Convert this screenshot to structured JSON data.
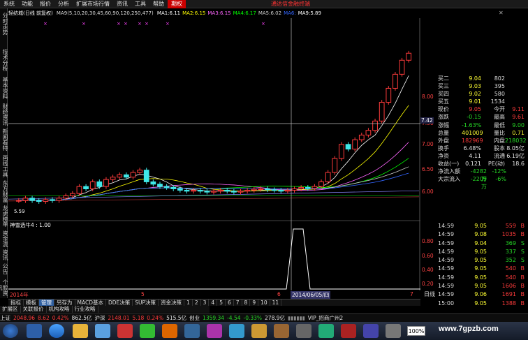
{
  "menu": {
    "items": [
      "系统",
      "功能",
      "报价",
      "分析",
      "扩展市场行情",
      "资讯",
      "工具",
      "帮助"
    ],
    "logo_item": "期权",
    "active_item": "期权",
    "promo_text": "通达信金融终端"
  },
  "side_tabs": [
    "分时走势",
    "技术分析",
    "基本资料",
    "财经资讯",
    "新闻看特",
    "画线工具",
    "东方财富",
    "龙虎榜",
    "单",
    "资金流",
    "资讯",
    "公告",
    "个股资讯"
  ],
  "chart_header": {
    "name": "轻纺城(日线 前复权)",
    "ma_spec": "MA9(5,10,20,30,45,60,90,120,250,477)",
    "mas": [
      {
        "label": "MA1:",
        "value": "6.11",
        "color": "#ffffff"
      },
      {
        "label": "MA2:",
        "value": "6.15",
        "color": "#ffff00"
      },
      {
        "label": "MA3:",
        "value": "6.15",
        "color": "#ff66ff"
      },
      {
        "label": "MA4:",
        "value": "6.17",
        "color": "#00ff00"
      },
      {
        "label": "MA5:",
        "value": "6.02",
        "color": "#cccccc"
      },
      {
        "label": "MA6:",
        "value": "",
        "color": "#3366ff"
      },
      {
        "label": "MA9:",
        "value": "5.89",
        "color": "#ffffff"
      }
    ]
  },
  "price_axis": {
    "labels": [
      "8.00",
      "7.50",
      "7.00",
      "6.50",
      "6.00"
    ],
    "crosshair_value": "7.42",
    "min_label": "5.59"
  },
  "indicator": {
    "title": "神雪选牛4 : 1.00",
    "axis_labels": [
      "0.80",
      "0.60",
      "0.40",
      "0.20"
    ]
  },
  "x_axis": {
    "labels": [
      "2014年",
      "5",
      "6",
      "7"
    ],
    "crosshair_date": "2014/06/05/四"
  },
  "quotes": {
    "rows_top": [
      {
        "label": "买二",
        "price": "9.04",
        "vol": "802"
      },
      {
        "label": "买三",
        "price": "9.03",
        "vol": "395"
      },
      {
        "label": "买四",
        "price": "9.02",
        "vol": "580"
      },
      {
        "label": "买五",
        "price": "9.01",
        "vol": "1534"
      }
    ],
    "stats": [
      {
        "l1": "现价",
        "v1": "9.05",
        "l2": "今开",
        "v2": "9.11"
      },
      {
        "l1": "涨跌",
        "v1": "-0.15",
        "l2": "最高",
        "v2": "9.61"
      },
      {
        "l1": "涨幅",
        "v1": "-1.63%",
        "l2": "最低",
        "v2": "9.00"
      },
      {
        "l1": "总量",
        "v1": "401009",
        "l2": "量比",
        "v2": "0.71"
      },
      {
        "l1": "外盘",
        "v1": "182969",
        "l2": "内盘",
        "v2": "218032"
      },
      {
        "l1": "换手",
        "v1": "6.48%",
        "l2": "股本",
        "v2": "8.05亿"
      },
      {
        "l1": "净资",
        "v1": "4.11",
        "l2": "流通",
        "v2": "6.19亿"
      },
      {
        "l1": "收益(一)",
        "v1": "0.121",
        "l2": "PE(动)",
        "v2": "18.6"
      }
    ],
    "flows": [
      {
        "label": "净流入额",
        "v1": "-4282万",
        "v2": "-12%"
      },
      {
        "label": "大宗流入",
        "v1": "-2209万",
        "v2": "-6%"
      }
    ]
  },
  "ticks": [
    {
      "t": "14:59",
      "p": "9.05",
      "v": "559",
      "bs": "B"
    },
    {
      "t": "14:59",
      "p": "9.08",
      "v": "1035",
      "bs": "B"
    },
    {
      "t": "14:59",
      "p": "9.04",
      "v": "369",
      "bs": "S"
    },
    {
      "t": "14:59",
      "p": "9.05",
      "v": "337",
      "bs": "S"
    },
    {
      "t": "14:59",
      "p": "9.05",
      "v": "352",
      "bs": "S"
    },
    {
      "t": "14:59",
      "p": "9.05",
      "v": "540",
      "bs": "B"
    },
    {
      "t": "14:59",
      "p": "9.05",
      "v": "540",
      "bs": "B"
    },
    {
      "t": "14:59",
      "p": "9.05",
      "v": "1606",
      "bs": "B"
    },
    {
      "t": "14:59",
      "p": "9.06",
      "v": "1691",
      "bs": "B"
    },
    {
      "t": "15:00",
      "p": "9.05",
      "v": "1388",
      "bs": "B"
    }
  ],
  "tabs1": [
    "指标",
    "模板",
    "管理",
    "另存为",
    "MACD基本",
    "DDE决策",
    "SUP决策",
    "资金决策",
    "1",
    "2",
    "3",
    "4",
    "5",
    "6",
    "7",
    "8",
    "9",
    "10",
    "11"
  ],
  "tabs1_active": "管理",
  "tabs2": [
    "扩展区",
    "关联报价",
    "机构攻略",
    "行业攻略"
  ],
  "period_tab": "日线",
  "status": {
    "sh_label": "上证",
    "sh_value": "2048.96",
    "sh_change": "8.62",
    "sh_pct": "0.42%",
    "sh_amount": "862.5亿",
    "sz_label": "沪深",
    "sz_value": "2148.01",
    "sz_change": "5.18",
    "sz_pct": "0.24%",
    "sz_amount": "515.5亿",
    "cy_label": "创业",
    "cy_value": "1359.34",
    "cy_change": "-4.54",
    "cy_pct": "-0.33%",
    "cy_amount": "278.9亿",
    "server": "VIP_招商广州2"
  },
  "taskbar": {
    "zoom": "100%",
    "watermark": "www.7gpzb.com"
  },
  "colors": {
    "up": "#ff3b3b",
    "down": "#26d926",
    "neutral": "#e6e6e6",
    "accent": "#2f5fa0"
  },
  "chart_data": {
    "type": "line",
    "title": "轻纺城(日线 前复权)",
    "candles_note": "daily candlestick with moving averages",
    "close": [
      5.9,
      5.95,
      5.9,
      5.88,
      5.92,
      5.9,
      5.95,
      6.0,
      6.05,
      6.2,
      6.15,
      6.3,
      6.2,
      6.35,
      6.4,
      6.45,
      6.4,
      6.5,
      6.55,
      6.3,
      6.25,
      6.2,
      6.18,
      6.15,
      6.12,
      6.1,
      6.12,
      6.1,
      6.08,
      6.1,
      6.12,
      6.1,
      6.08,
      6.1,
      6.12,
      6.14,
      6.15,
      6.13,
      6.12,
      6.1,
      6.12,
      6.15,
      6.18,
      6.16,
      6.2,
      6.3,
      6.5,
      6.8,
      7.1,
      7.0,
      7.2,
      7.3,
      7.4,
      7.6,
      8.0,
      8.3,
      8.6,
      8.9,
      9.05
    ],
    "ylim": [
      5.5,
      9.8
    ],
    "indicator_series": {
      "name": "神雪选牛4",
      "values_at_signal": [
        0,
        1,
        1,
        0
      ]
    }
  }
}
